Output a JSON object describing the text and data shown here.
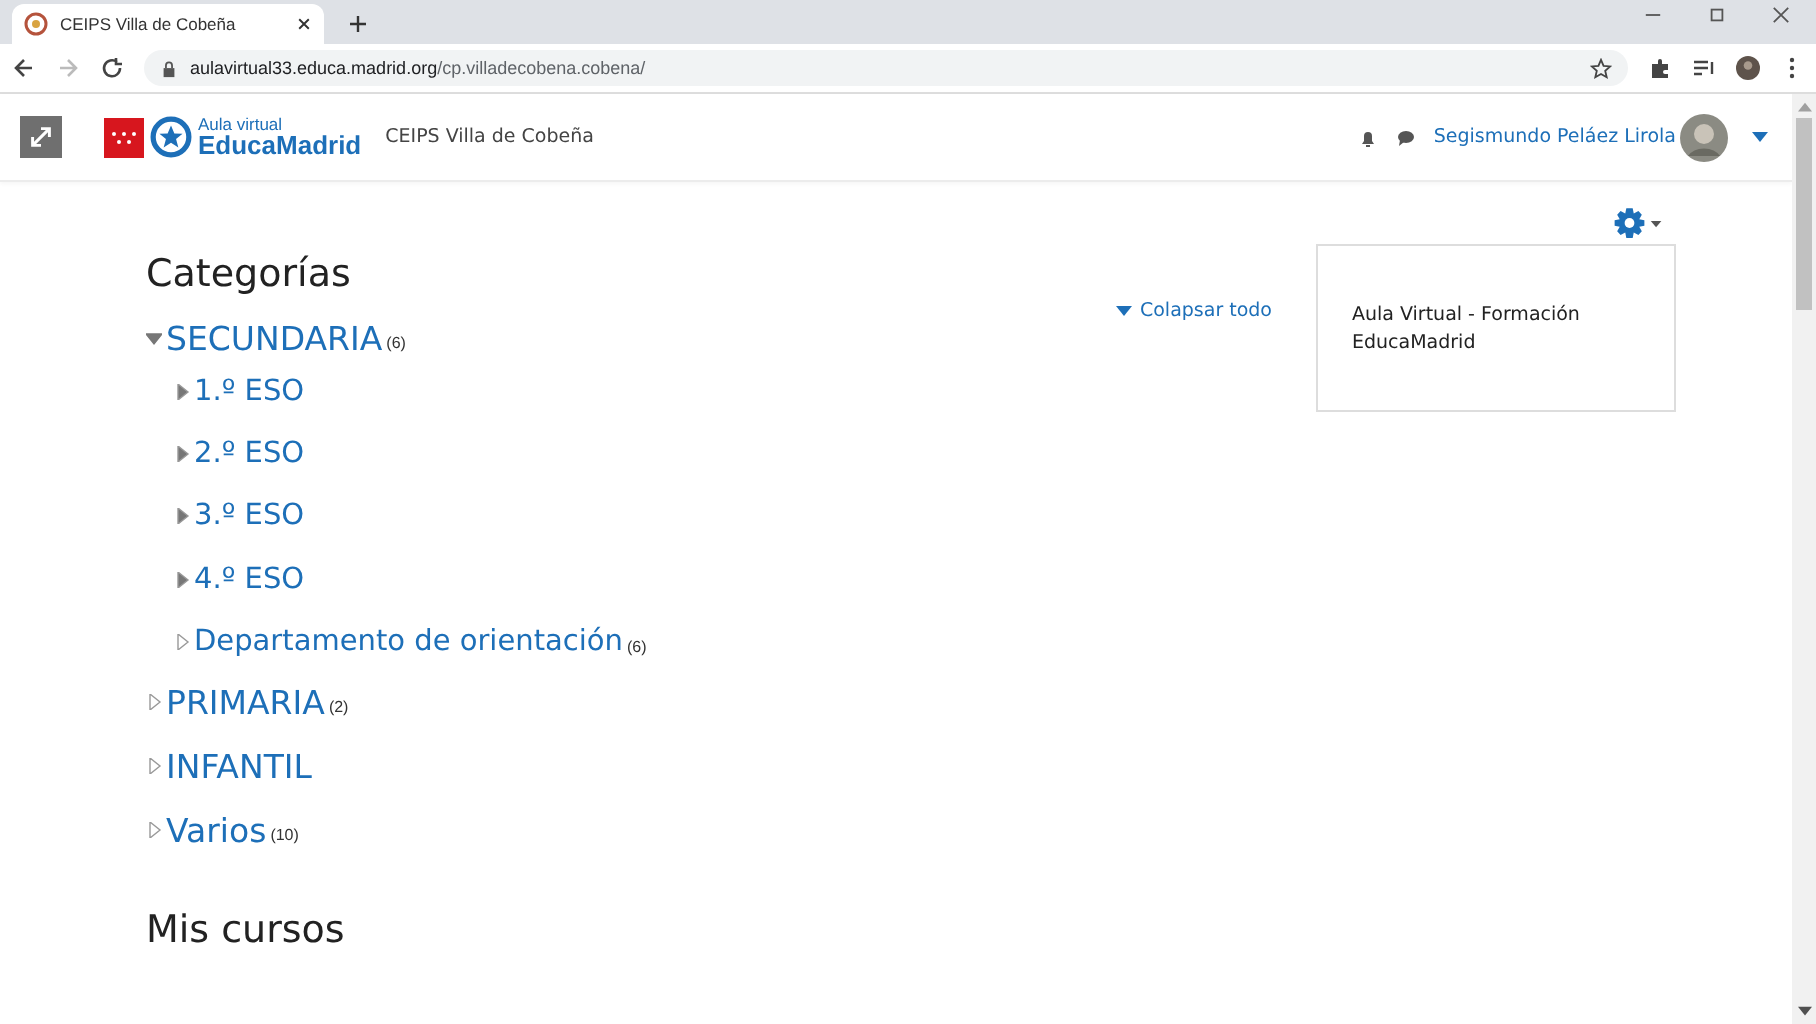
{
  "browser": {
    "tab_title": "CEIPS Villa de Cobeña",
    "url_host": "aulavirtual33.educa.madrid.org",
    "url_path": "/cp.villadecobena.cobena/"
  },
  "header": {
    "logo_small": "Aula virtual",
    "logo_big": "EducaMadrid",
    "site_name": "CEIPS Villa de Cobeña",
    "user_name": "Segismundo Peláez Lirola"
  },
  "categories": {
    "title": "Categorías",
    "collapse_all": "Colapsar todo",
    "items": [
      {
        "label": "SECUNDARIA",
        "count": "(6)",
        "expanded": true,
        "loaded": true,
        "children": [
          {
            "label": "1.º ESO",
            "expanded": false,
            "loaded": true
          },
          {
            "label": "2.º ESO",
            "expanded": false,
            "loaded": true
          },
          {
            "label": "3.º ESO",
            "expanded": false,
            "loaded": true
          },
          {
            "label": "4.º ESO",
            "expanded": false,
            "loaded": true
          },
          {
            "label": "Departamento de orientación",
            "count": "(6)",
            "expanded": false,
            "loaded": false
          }
        ]
      },
      {
        "label": "PRIMARIA",
        "count": "(2)",
        "expanded": false,
        "loaded": false
      },
      {
        "label": "INFANTIL",
        "expanded": false,
        "loaded": false
      },
      {
        "label": "Varios",
        "count": "(10)",
        "expanded": false,
        "loaded": false
      }
    ]
  },
  "block": {
    "text": "Aula Virtual - Formación EducaMadrid"
  },
  "my_courses": {
    "title": "Mis cursos"
  }
}
